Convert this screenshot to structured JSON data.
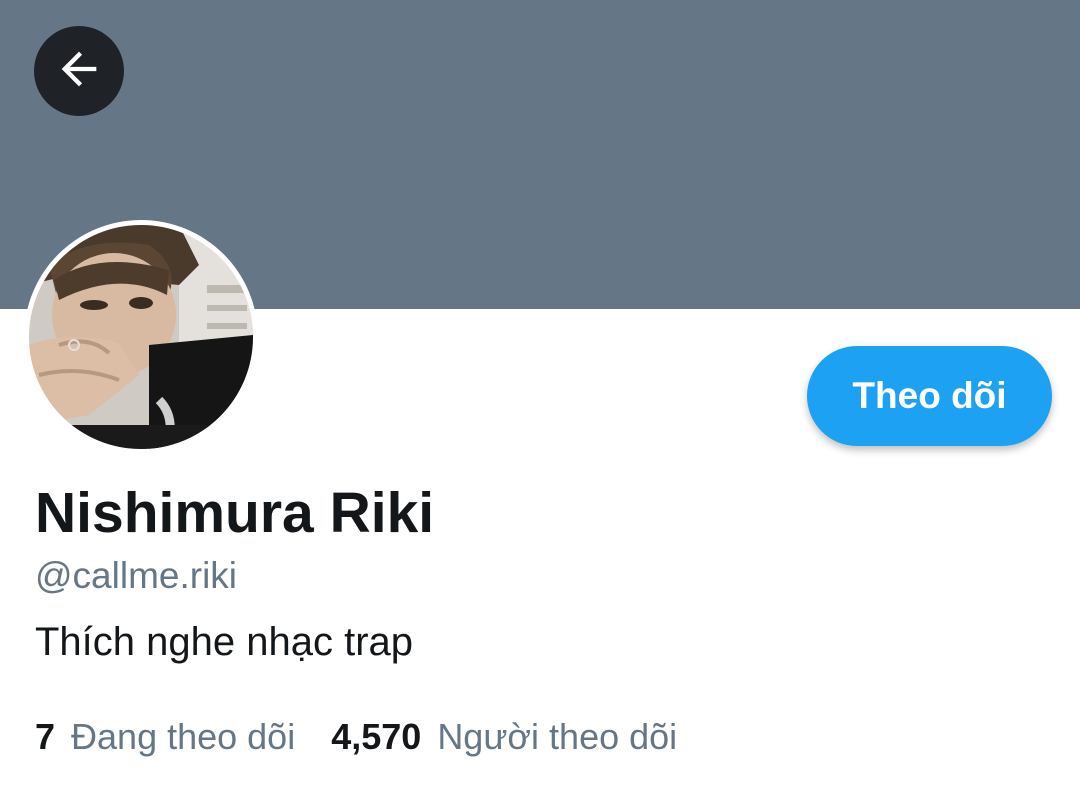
{
  "profile": {
    "display_name": "Nishimura Riki",
    "handle": "@callme.riki",
    "bio": "Thích nghe nhạc trap",
    "banner_color": "#657786",
    "avatar_icon": "profile-photo"
  },
  "header": {
    "back_icon": "arrow-left-icon"
  },
  "actions": {
    "follow_label": "Theo dõi",
    "accent_color": "#1da1f2"
  },
  "stats": {
    "following_count": "7",
    "following_label": "Đang theo dõi",
    "followers_count": "4,570",
    "followers_label": "Người theo dõi"
  }
}
